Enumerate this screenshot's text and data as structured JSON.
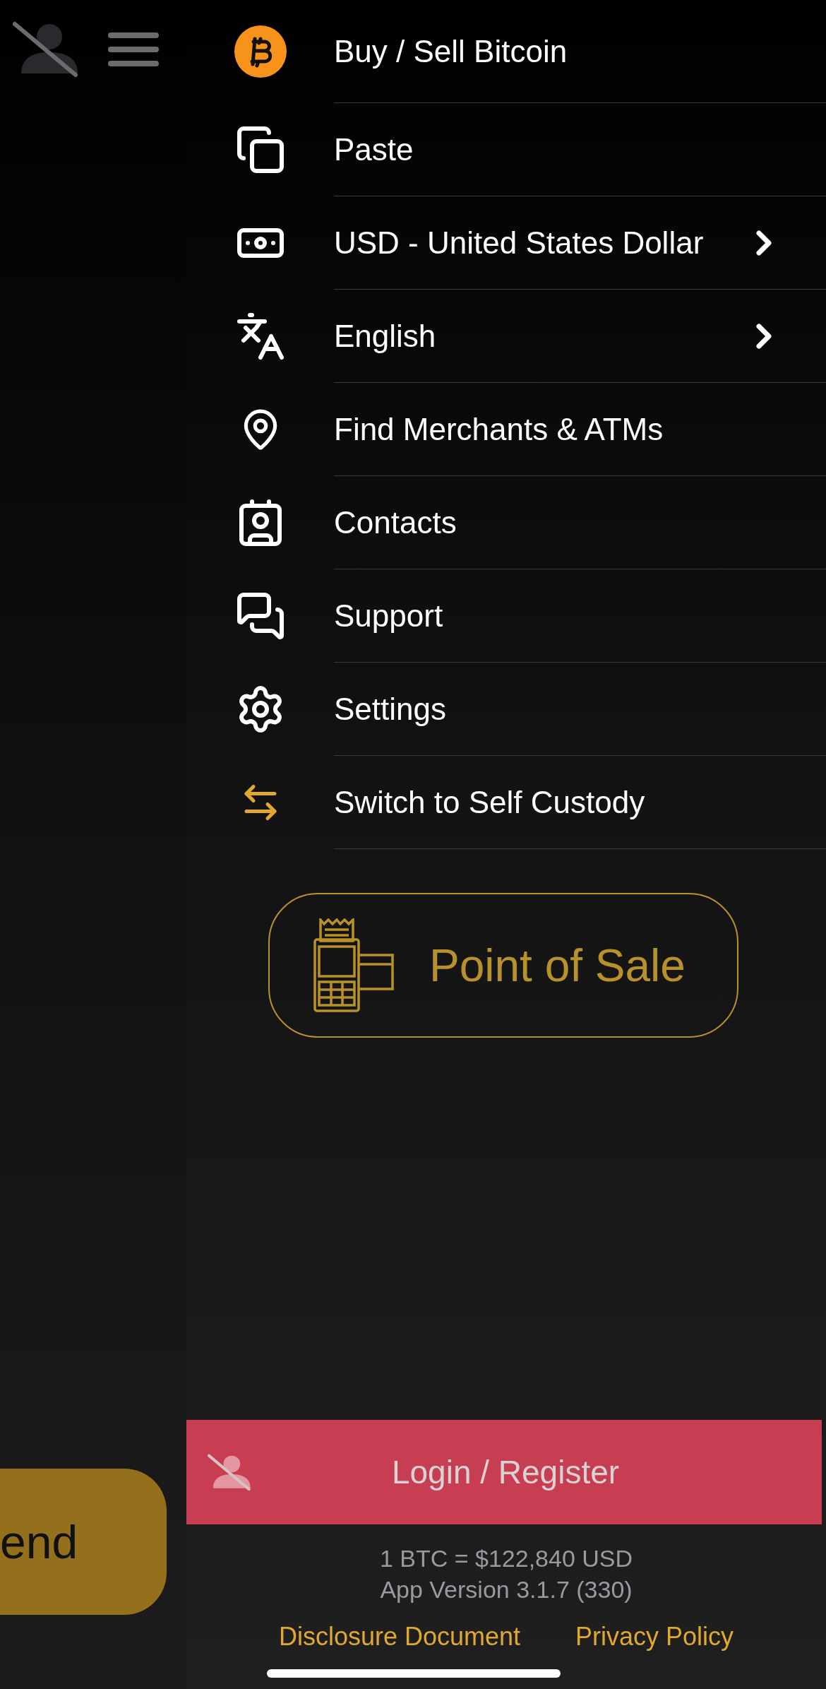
{
  "side_panel": {
    "send_button": "end"
  },
  "menu": {
    "items": [
      {
        "label": "Buy / Sell Bitcoin",
        "chevron": false
      },
      {
        "label": "Paste",
        "chevron": false
      },
      {
        "label": "USD - United States Dollar",
        "chevron": true
      },
      {
        "label": "English",
        "chevron": true
      },
      {
        "label": "Find Merchants & ATMs",
        "chevron": false
      },
      {
        "label": "Contacts",
        "chevron": false
      },
      {
        "label": "Support",
        "chevron": false
      },
      {
        "label": "Settings",
        "chevron": false
      },
      {
        "label": "Switch to Self Custody",
        "chevron": false
      }
    ]
  },
  "point_of_sale": {
    "label": "Point of Sale"
  },
  "login": {
    "label": "Login / Register"
  },
  "footer": {
    "rate": "1 BTC = $122,840 USD",
    "version": "App Version 3.1.7 (330)",
    "links": [
      "Disclosure Document",
      "Privacy Policy"
    ]
  }
}
